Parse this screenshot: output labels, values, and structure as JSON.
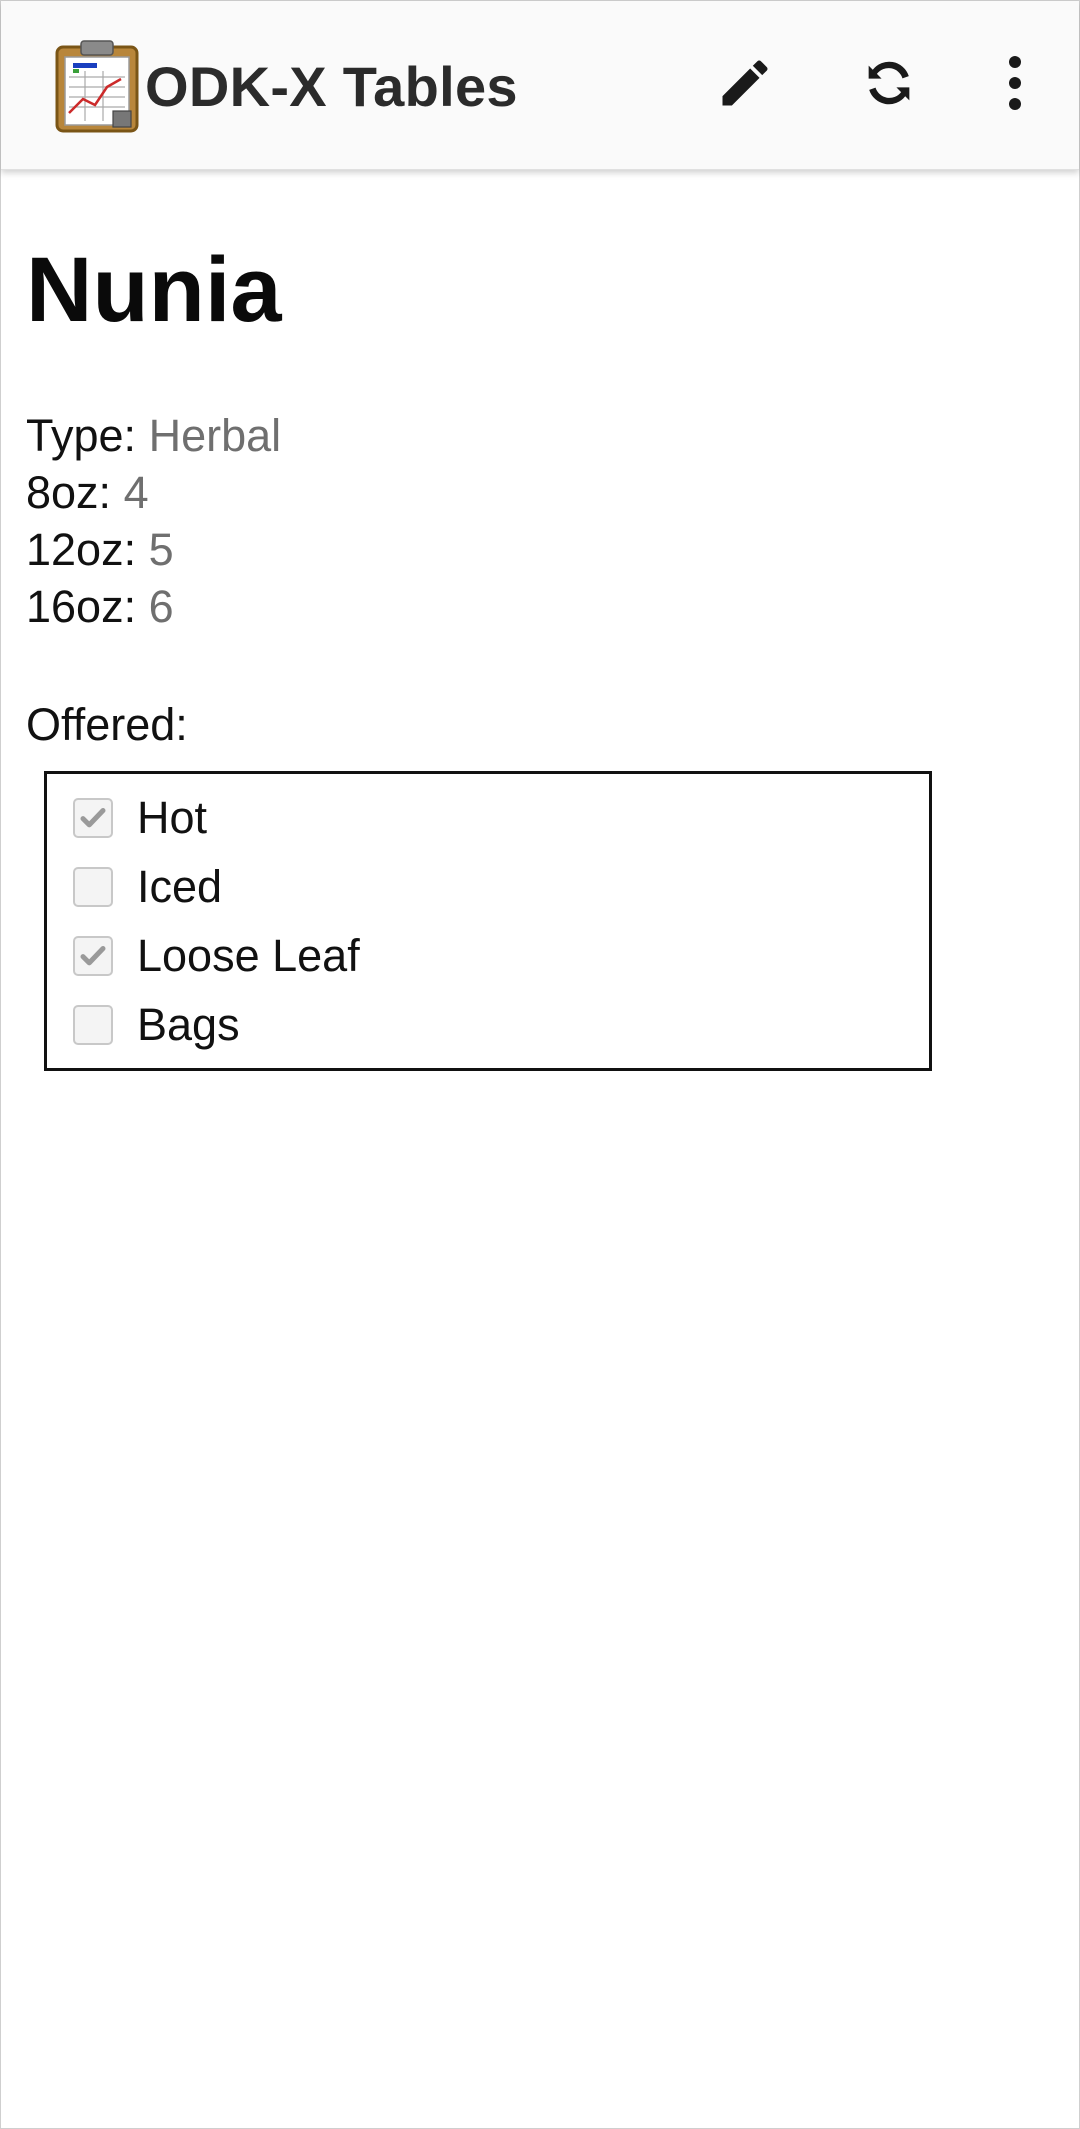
{
  "app_bar": {
    "title": "ODK-X Tables",
    "icons": {
      "app_logo": "clipboard-chart-icon",
      "edit": "pencil-icon",
      "sync": "sync-icon",
      "more": "more-vert-icon"
    }
  },
  "record": {
    "title": "Nunia",
    "fields": [
      {
        "label": "Type:",
        "value": "Herbal"
      },
      {
        "label": "8oz:",
        "value": "4"
      },
      {
        "label": "12oz:",
        "value": "5"
      },
      {
        "label": "16oz:",
        "value": "6"
      }
    ],
    "offered_label": "Offered:",
    "offered_options": [
      {
        "label": "Hot",
        "checked": true
      },
      {
        "label": "Iced",
        "checked": false
      },
      {
        "label": "Loose Leaf",
        "checked": true
      },
      {
        "label": "Bags",
        "checked": false
      }
    ]
  },
  "colors": {
    "appbar_bg": "#fafafa",
    "value_text": "#6f6f6f",
    "checkbox_check": "#9a9a9a"
  }
}
